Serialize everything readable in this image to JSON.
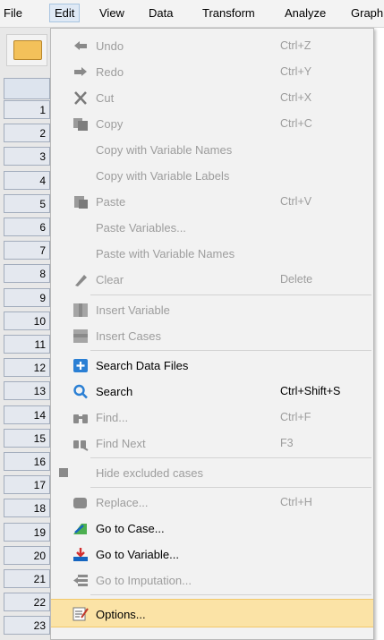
{
  "menubar": {
    "items": [
      {
        "label": "File"
      },
      {
        "label": "Edit"
      },
      {
        "label": "View"
      },
      {
        "label": "Data"
      },
      {
        "label": "Transform"
      },
      {
        "label": "Analyze"
      },
      {
        "label": "Graph"
      }
    ]
  },
  "grid": {
    "row_numbers": [
      "1",
      "2",
      "3",
      "4",
      "5",
      "6",
      "7",
      "8",
      "9",
      "10",
      "11",
      "12",
      "13",
      "14",
      "15",
      "16",
      "17",
      "18",
      "19",
      "20",
      "21",
      "22",
      "23"
    ]
  },
  "edit_menu": {
    "items": [
      {
        "label": "Undo",
        "shortcut": "Ctrl+Z",
        "enabled": false,
        "icon": "undo-icon"
      },
      {
        "label": "Redo",
        "shortcut": "Ctrl+Y",
        "enabled": false,
        "icon": "redo-icon"
      },
      {
        "label": "Cut",
        "shortcut": "Ctrl+X",
        "enabled": false,
        "icon": "cut-icon"
      },
      {
        "label": "Copy",
        "shortcut": "Ctrl+C",
        "enabled": false,
        "icon": "copy-icon"
      },
      {
        "label": "Copy with Variable Names",
        "shortcut": "",
        "enabled": false,
        "icon": ""
      },
      {
        "label": "Copy with Variable Labels",
        "shortcut": "",
        "enabled": false,
        "icon": ""
      },
      {
        "label": "Paste",
        "shortcut": "Ctrl+V",
        "enabled": false,
        "icon": "paste-icon"
      },
      {
        "label": "Paste Variables...",
        "shortcut": "",
        "enabled": false,
        "icon": ""
      },
      {
        "label": "Paste with Variable Names",
        "shortcut": "",
        "enabled": false,
        "icon": ""
      },
      {
        "label": "Clear",
        "shortcut": "Delete",
        "enabled": false,
        "icon": "eraser-icon"
      },
      {
        "label": "Insert Variable",
        "shortcut": "",
        "enabled": false,
        "icon": "insert-variable-icon"
      },
      {
        "label": "Insert Cases",
        "shortcut": "",
        "enabled": false,
        "icon": "insert-cases-icon"
      },
      {
        "label": "Search Data Files",
        "shortcut": "",
        "enabled": true,
        "icon": "plus-icon"
      },
      {
        "label": "Search",
        "shortcut": "Ctrl+Shift+S",
        "enabled": true,
        "icon": "search-icon"
      },
      {
        "label": "Find...",
        "shortcut": "Ctrl+F",
        "enabled": false,
        "icon": "binoculars-icon"
      },
      {
        "label": "Find Next",
        "shortcut": "F3",
        "enabled": false,
        "icon": "find-next-icon"
      },
      {
        "label": "Hide excluded cases",
        "shortcut": "",
        "enabled": false,
        "icon": "checkbox-icon"
      },
      {
        "label": "Replace...",
        "shortcut": "Ctrl+H",
        "enabled": false,
        "icon": "replace-icon"
      },
      {
        "label": "Go to Case...",
        "shortcut": "",
        "enabled": true,
        "icon": "go-to-case-icon"
      },
      {
        "label": "Go to Variable...",
        "shortcut": "",
        "enabled": true,
        "icon": "go-to-variable-icon"
      },
      {
        "label": "Go to Imputation...",
        "shortcut": "",
        "enabled": false,
        "icon": "go-to-imputation-icon"
      },
      {
        "label": "Options...",
        "shortcut": "",
        "enabled": true,
        "highlighted": true,
        "icon": "options-icon"
      }
    ]
  },
  "colors": {
    "highlight": "#fbe3a6",
    "disabled_text": "#9d9d9d",
    "menu_bg": "#f2f2f2",
    "accent_blue": "#2a7fd4"
  }
}
